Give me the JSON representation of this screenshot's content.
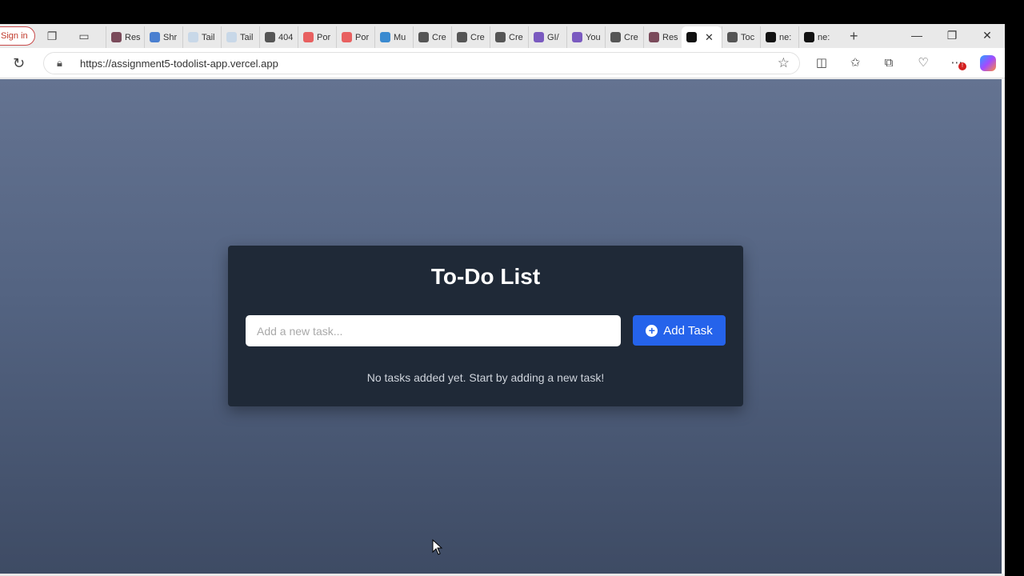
{
  "browser": {
    "signin_label": "Sign in",
    "tabs": [
      {
        "label": "Res",
        "color": "#7a4a5a"
      },
      {
        "label": "Shr",
        "color": "#4a7fd0"
      },
      {
        "label": "Tail",
        "color": "#c8d8e8"
      },
      {
        "label": "Tail",
        "color": "#c8d8e8"
      },
      {
        "label": "404",
        "color": "#555555"
      },
      {
        "label": "Por",
        "color": "#e86060"
      },
      {
        "label": "Por",
        "color": "#e86060"
      },
      {
        "label": "Mu",
        "color": "#3a8ad0"
      },
      {
        "label": "Cre",
        "color": "#555555"
      },
      {
        "label": "Cre",
        "color": "#555555"
      },
      {
        "label": "Cre",
        "color": "#555555"
      },
      {
        "label": "GI/",
        "color": "#7a5ac0"
      },
      {
        "label": "You",
        "color": "#7a5ac0"
      },
      {
        "label": "Cre",
        "color": "#555555"
      },
      {
        "label": "Res",
        "color": "#7a4a5a"
      },
      {
        "label": "",
        "color": "#111111",
        "active": true
      },
      {
        "label": "Toc",
        "color": "#555555"
      },
      {
        "label": "ne:",
        "color": "#111111"
      },
      {
        "label": "ne:",
        "color": "#111111"
      }
    ],
    "url": "https://assignment5-todolist-app.vercel.app"
  },
  "app": {
    "title": "To-Do List",
    "input_placeholder": "Add a new task...",
    "add_button_label": "Add Task",
    "empty_message": "No tasks added yet. Start by adding a new task!",
    "accent_color": "#2563eb"
  }
}
